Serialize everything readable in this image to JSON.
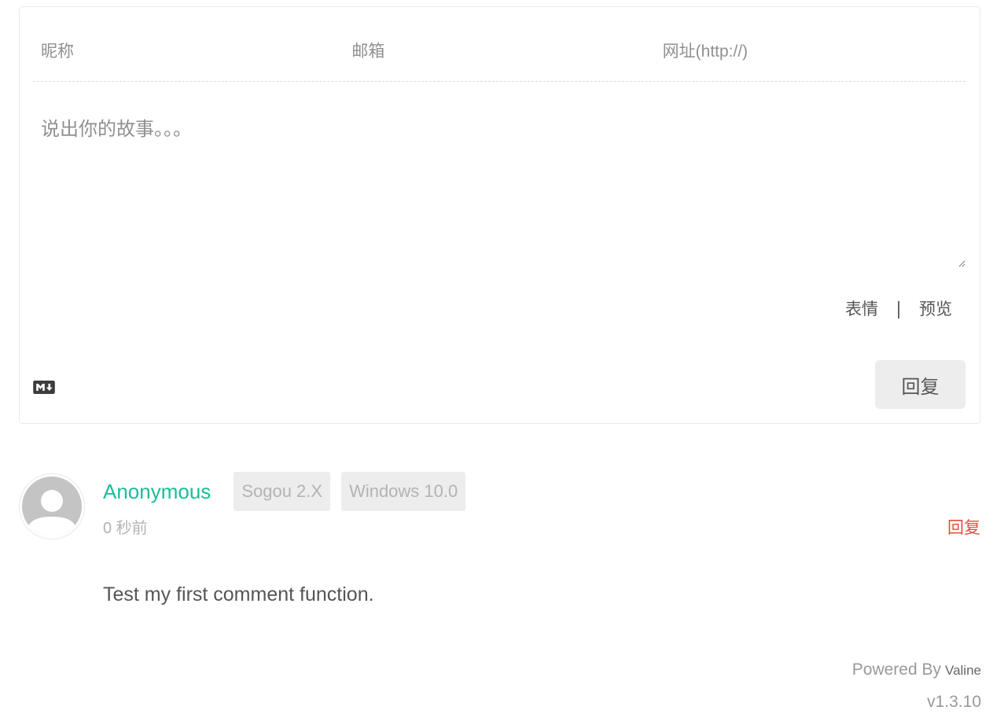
{
  "comment_form": {
    "nick_placeholder": "昵称",
    "mail_placeholder": "邮箱",
    "link_placeholder": "网址(http://)",
    "editor_placeholder": "说出你的故事。。。",
    "emoji_label": "表情",
    "preview_label": "预览",
    "markdown_icon": "markdown-icon",
    "submit_label": "回复"
  },
  "comments": [
    {
      "avatar_icon": "default-avatar-icon",
      "nick": "Anonymous",
      "browser": "Sogou 2.X",
      "os": "Windows 10.0",
      "time": "0 秒前",
      "reply_label": "回复",
      "content": "Test my first comment function."
    }
  ],
  "footer": {
    "powered_by": "Powered By",
    "brand": "Valine",
    "version": "v1.3.10"
  },
  "colors": {
    "accent": "#1abc9c",
    "reply_link": "#e5503a",
    "badge_bg": "#ededed",
    "badge_text": "#b3b3b3",
    "button_bg": "#ededed"
  }
}
